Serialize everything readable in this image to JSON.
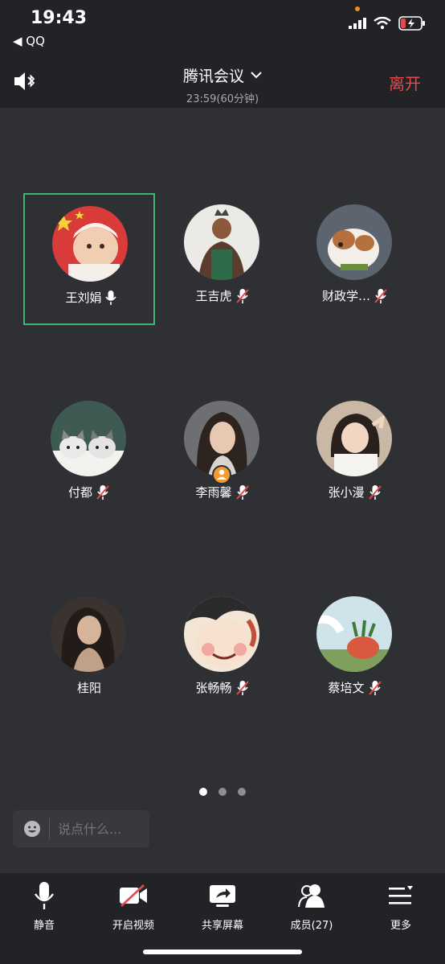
{
  "status_bar": {
    "time": "19:43",
    "back_app": "◀ QQ"
  },
  "header": {
    "title": "腾讯会议",
    "subtitle": "23:59(60分钟)",
    "leave_label": "离开"
  },
  "participants": [
    {
      "name": "王刘娟",
      "mic": "on",
      "active": true
    },
    {
      "name": "王吉虎",
      "mic": "muted"
    },
    {
      "name": "财政学…",
      "mic": "muted"
    },
    {
      "name": "付都",
      "mic": "muted"
    },
    {
      "name": "李雨馨",
      "mic": "muted",
      "host": true
    },
    {
      "name": "张小漫",
      "mic": "muted"
    },
    {
      "name": "桂阳",
      "mic": "none"
    },
    {
      "name": "张畅畅",
      "mic": "muted"
    },
    {
      "name": "蔡培文",
      "mic": "muted"
    }
  ],
  "pager": {
    "pages": 3,
    "current": 1
  },
  "chat": {
    "placeholder": "说点什么..."
  },
  "toolbar": {
    "mute_label": "静音",
    "video_label": "开启视频",
    "share_label": "共享屏幕",
    "members_label": "成员(27)",
    "more_label": "更多"
  },
  "colors": {
    "accent_red": "#e5484d",
    "active_border": "#3fb66b",
    "host_badge": "#f39b33"
  }
}
